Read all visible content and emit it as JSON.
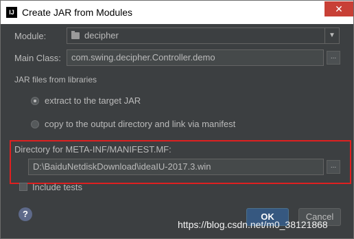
{
  "window": {
    "title": "Create JAR from Modules",
    "app_icon": "IJ",
    "close_glyph": "✕"
  },
  "module": {
    "label": "Module:",
    "value": "decipher"
  },
  "main_class": {
    "label": "Main Class:",
    "value": "com.swing.decipher.Controller.demo",
    "browse_label": "..."
  },
  "jar_files": {
    "section_label": "JAR files from libraries",
    "options": [
      {
        "label": "extract to the target JAR",
        "selected": true
      },
      {
        "label": "copy to the output directory and link via manifest",
        "selected": false
      }
    ]
  },
  "manifest": {
    "label": "Directory for META-INF/MANIFEST.MF:",
    "value": "D:\\BaiduNetdiskDownload\\ideaIU-2017.3.win",
    "browse_label": "..."
  },
  "include_tests": {
    "label": "Include tests",
    "checked": false
  },
  "buttons": {
    "help": "?",
    "ok": "OK",
    "cancel": "Cancel"
  },
  "watermark": "https://blog.csdn.net/m0_38121868",
  "colors": {
    "background": "#3c3f41",
    "highlight_border": "#e02020",
    "ok_button": "#365880",
    "close_button": "#c84036"
  }
}
